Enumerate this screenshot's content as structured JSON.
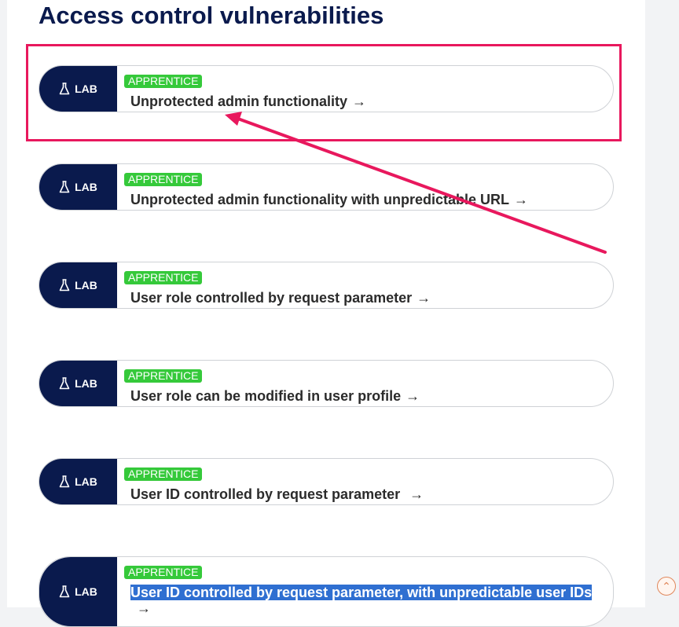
{
  "page": {
    "title": "Access control vulnerabilities"
  },
  "labs": [
    {
      "tag": "LAB",
      "level": "APPRENTICE",
      "title": "Unprotected admin functionality",
      "arrow": "→"
    },
    {
      "tag": "LAB",
      "level": "APPRENTICE",
      "title": "Unprotected admin functionality with unpredictable URL",
      "arrow": "→"
    },
    {
      "tag": "LAB",
      "level": "APPRENTICE",
      "title": "User role controlled by request parameter",
      "arrow": "→"
    },
    {
      "tag": "LAB",
      "level": "APPRENTICE",
      "title": "User role can be modified in user profile",
      "arrow": "→"
    },
    {
      "tag": "LAB",
      "level": "APPRENTICE",
      "title": "User ID controlled by request parameter",
      "arrow": "→"
    },
    {
      "tag": "LAB",
      "level": "APPRENTICE",
      "title": "User ID controlled by request parameter, with unpredictable user IDs",
      "arrow": "→",
      "selected": true
    }
  ],
  "colors": {
    "navy": "#0a1a4d",
    "badge_green": "#35c93a",
    "annotation_pink": "#e8185d",
    "selection_blue": "#2f6fd1"
  },
  "icons": {
    "lab": "flask-icon",
    "link": "arrow-right-icon",
    "scroll": "chevron-up-icon"
  },
  "scroll_top": {
    "symbol": "⌃"
  }
}
